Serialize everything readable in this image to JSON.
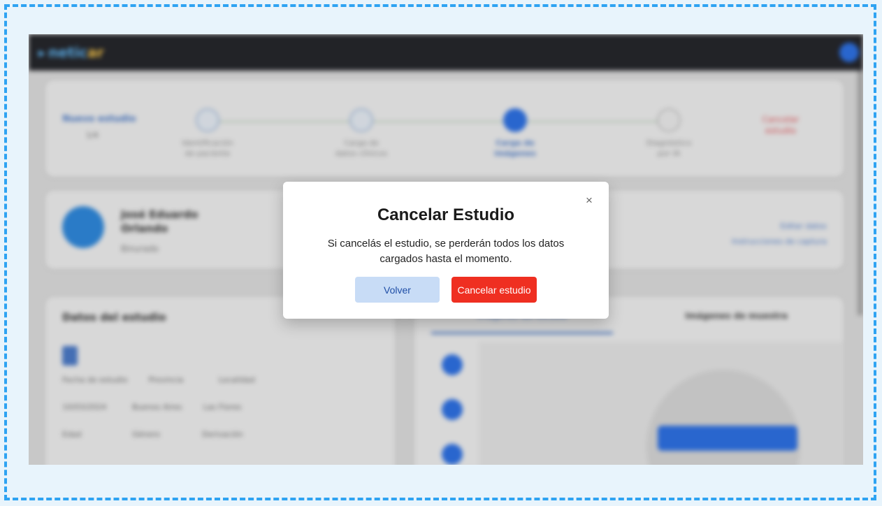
{
  "modal": {
    "title": "Cancelar Estudio",
    "message": "Si cancelás el estudio, se perderán todos los datos cargados hasta el momento.",
    "back_label": "Volver",
    "cancel_label": "Cancelar estudio",
    "close_symbol": "×"
  },
  "icons": {
    "close": "close-icon",
    "user": "user-icon",
    "document": "document-icon"
  },
  "colors": {
    "frame_border": "#2ea3f2",
    "cancel_button": "#ef2f21",
    "back_button": "#c8dcf6",
    "back_button_text": "#1f4ea6",
    "topbar": "#25262b",
    "accent_blue": "#2d6fe0"
  }
}
